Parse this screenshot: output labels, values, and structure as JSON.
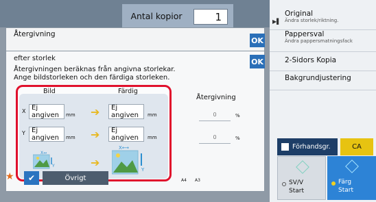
{
  "header": {
    "copies_label": "Antal kopior",
    "copies_value": "1"
  },
  "right_panel": {
    "items": [
      {
        "title": "Original",
        "sub": "Ändra storlek/riktning."
      },
      {
        "title": "Pappersval",
        "sub": "Ändra pappersmatningsfack"
      },
      {
        "title": "2-Sidors Kopia",
        "sub": ""
      },
      {
        "title": "Bakgrundjustering",
        "sub": ""
      }
    ],
    "preview_label": "Förhandsgr.",
    "ca_label": "CA",
    "sv_label": "SV/V",
    "sv_start": "Start",
    "farg_label": "Färg",
    "farg_start": "Start"
  },
  "dialog1": {
    "title": "Återgivning",
    "ok": "OK"
  },
  "dialog2": {
    "title": "efter storlek",
    "ok": "OK",
    "desc_line1": "Återgivningen beräknas från angivna storlekar.",
    "desc_line2": "Ange bildstorleken och den färdiga storleken.",
    "col_bild": "Bild",
    "col_fardig": "Färdig",
    "row_x": "X",
    "row_y": "Y",
    "fields": {
      "x_bild": "Ej angiven",
      "x_fardig": "Ej angiven",
      "y_bild": "Ej angiven",
      "y_fardig": "Ej angiven"
    },
    "unit": "mm",
    "ater_label": "Återgivning",
    "ater_x": "0",
    "ater_y": "0",
    "pct": "%"
  },
  "bottom": {
    "ovrigt": "Övrigt",
    "paper_labels": [
      "A4",
      "A3"
    ]
  },
  "colors": {
    "ok_blue": "#2a6fb8",
    "highlight_red": "#e0102c",
    "arrow_yellow": "#e8b820",
    "farg_blue": "#2d83d6"
  }
}
